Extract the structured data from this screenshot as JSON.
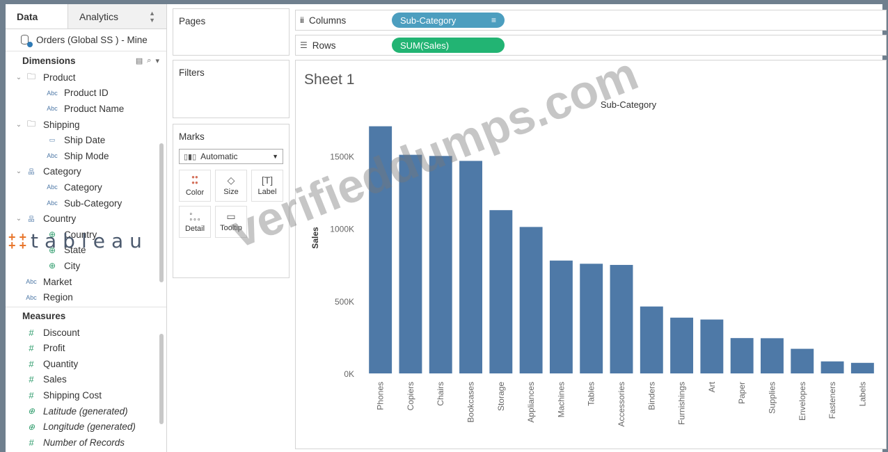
{
  "data_pane": {
    "tabs": [
      {
        "label": "Data"
      },
      {
        "label": "Analytics"
      }
    ],
    "datasource": "Orders (Global SS ) - Mine",
    "dimensions_title": "Dimensions",
    "dimensions": [
      {
        "label": "Product",
        "kind": "folder",
        "level": 1
      },
      {
        "label": "Product ID",
        "kind": "abc",
        "level": 2
      },
      {
        "label": "Product Name",
        "kind": "abc",
        "level": 2
      },
      {
        "label": "Shipping",
        "kind": "folder",
        "level": 1
      },
      {
        "label": "Ship Date",
        "kind": "date",
        "level": 2
      },
      {
        "label": "Ship Mode",
        "kind": "abc",
        "level": 2
      },
      {
        "label": "Category",
        "kind": "hier",
        "level": 1
      },
      {
        "label": "Category",
        "kind": "abc",
        "level": 2
      },
      {
        "label": "Sub-Category",
        "kind": "abc",
        "level": 2
      },
      {
        "label": "Country",
        "kind": "hier",
        "level": 1
      },
      {
        "label": "Country",
        "kind": "globe",
        "level": 2
      },
      {
        "label": "State",
        "kind": "globe",
        "level": 2
      },
      {
        "label": "City",
        "kind": "globe",
        "level": 2
      },
      {
        "label": "Market",
        "kind": "abc",
        "level": 0
      },
      {
        "label": "Region",
        "kind": "abc",
        "level": 0
      }
    ],
    "measures_title": "Measures",
    "measures": [
      {
        "label": "Discount",
        "kind": "hash"
      },
      {
        "label": "Profit",
        "kind": "hash"
      },
      {
        "label": "Quantity",
        "kind": "hash"
      },
      {
        "label": "Sales",
        "kind": "hash"
      },
      {
        "label": "Shipping Cost",
        "kind": "hash"
      },
      {
        "label": "Latitude (generated)",
        "kind": "globe",
        "italic": true
      },
      {
        "label": "Longitude (generated)",
        "kind": "globe",
        "italic": true
      },
      {
        "label": "Number of Records",
        "kind": "hash",
        "italic": true
      }
    ]
  },
  "logo": {
    "text": "tableau"
  },
  "cards": {
    "pages": "Pages",
    "filters": "Filters",
    "marks": "Marks"
  },
  "marks": {
    "type": "Automatic",
    "buttons": [
      {
        "label": "Color",
        "icon": "color-icon"
      },
      {
        "label": "Size",
        "icon": "size-icon"
      },
      {
        "label": "Label",
        "icon": "label-icon"
      },
      {
        "label": "Detail",
        "icon": "detail-icon"
      },
      {
        "label": "Tooltip",
        "icon": "tooltip-icon"
      }
    ]
  },
  "shelves": {
    "columns_label": "Columns",
    "columns_pill": "Sub-Category",
    "rows_label": "Rows",
    "rows_pill": "SUM(Sales)"
  },
  "sheet_title": "Sheet 1",
  "watermark": "verifieddumps.com",
  "colors": {
    "bar": "#4e79a7",
    "pill_dimension": "#4c9ebf",
    "pill_measure": "#22b473"
  },
  "chart_data": {
    "type": "bar",
    "title": "Sub-Category",
    "xlabel": "",
    "ylabel": "Sales",
    "ylim": [
      0,
      1800000
    ],
    "yticks": [
      {
        "v": 0,
        "label": "0K"
      },
      {
        "v": 500000,
        "label": "500K"
      },
      {
        "v": 1000000,
        "label": "1000K"
      },
      {
        "v": 1500000,
        "label": "1500K"
      }
    ],
    "categories": [
      "Phones",
      "Copiers",
      "Chairs",
      "Bookcases",
      "Storage",
      "Appliances",
      "Machines",
      "Tables",
      "Accessories",
      "Binders",
      "Furnishings",
      "Art",
      "Paper",
      "Supplies",
      "Envelopes",
      "Fasteners",
      "Labels"
    ],
    "values": [
      1706000,
      1509000,
      1501000,
      1467000,
      1127000,
      1011000,
      779000,
      757000,
      749000,
      462000,
      385000,
      372000,
      244000,
      243000,
      170000,
      83000,
      73000
    ]
  }
}
